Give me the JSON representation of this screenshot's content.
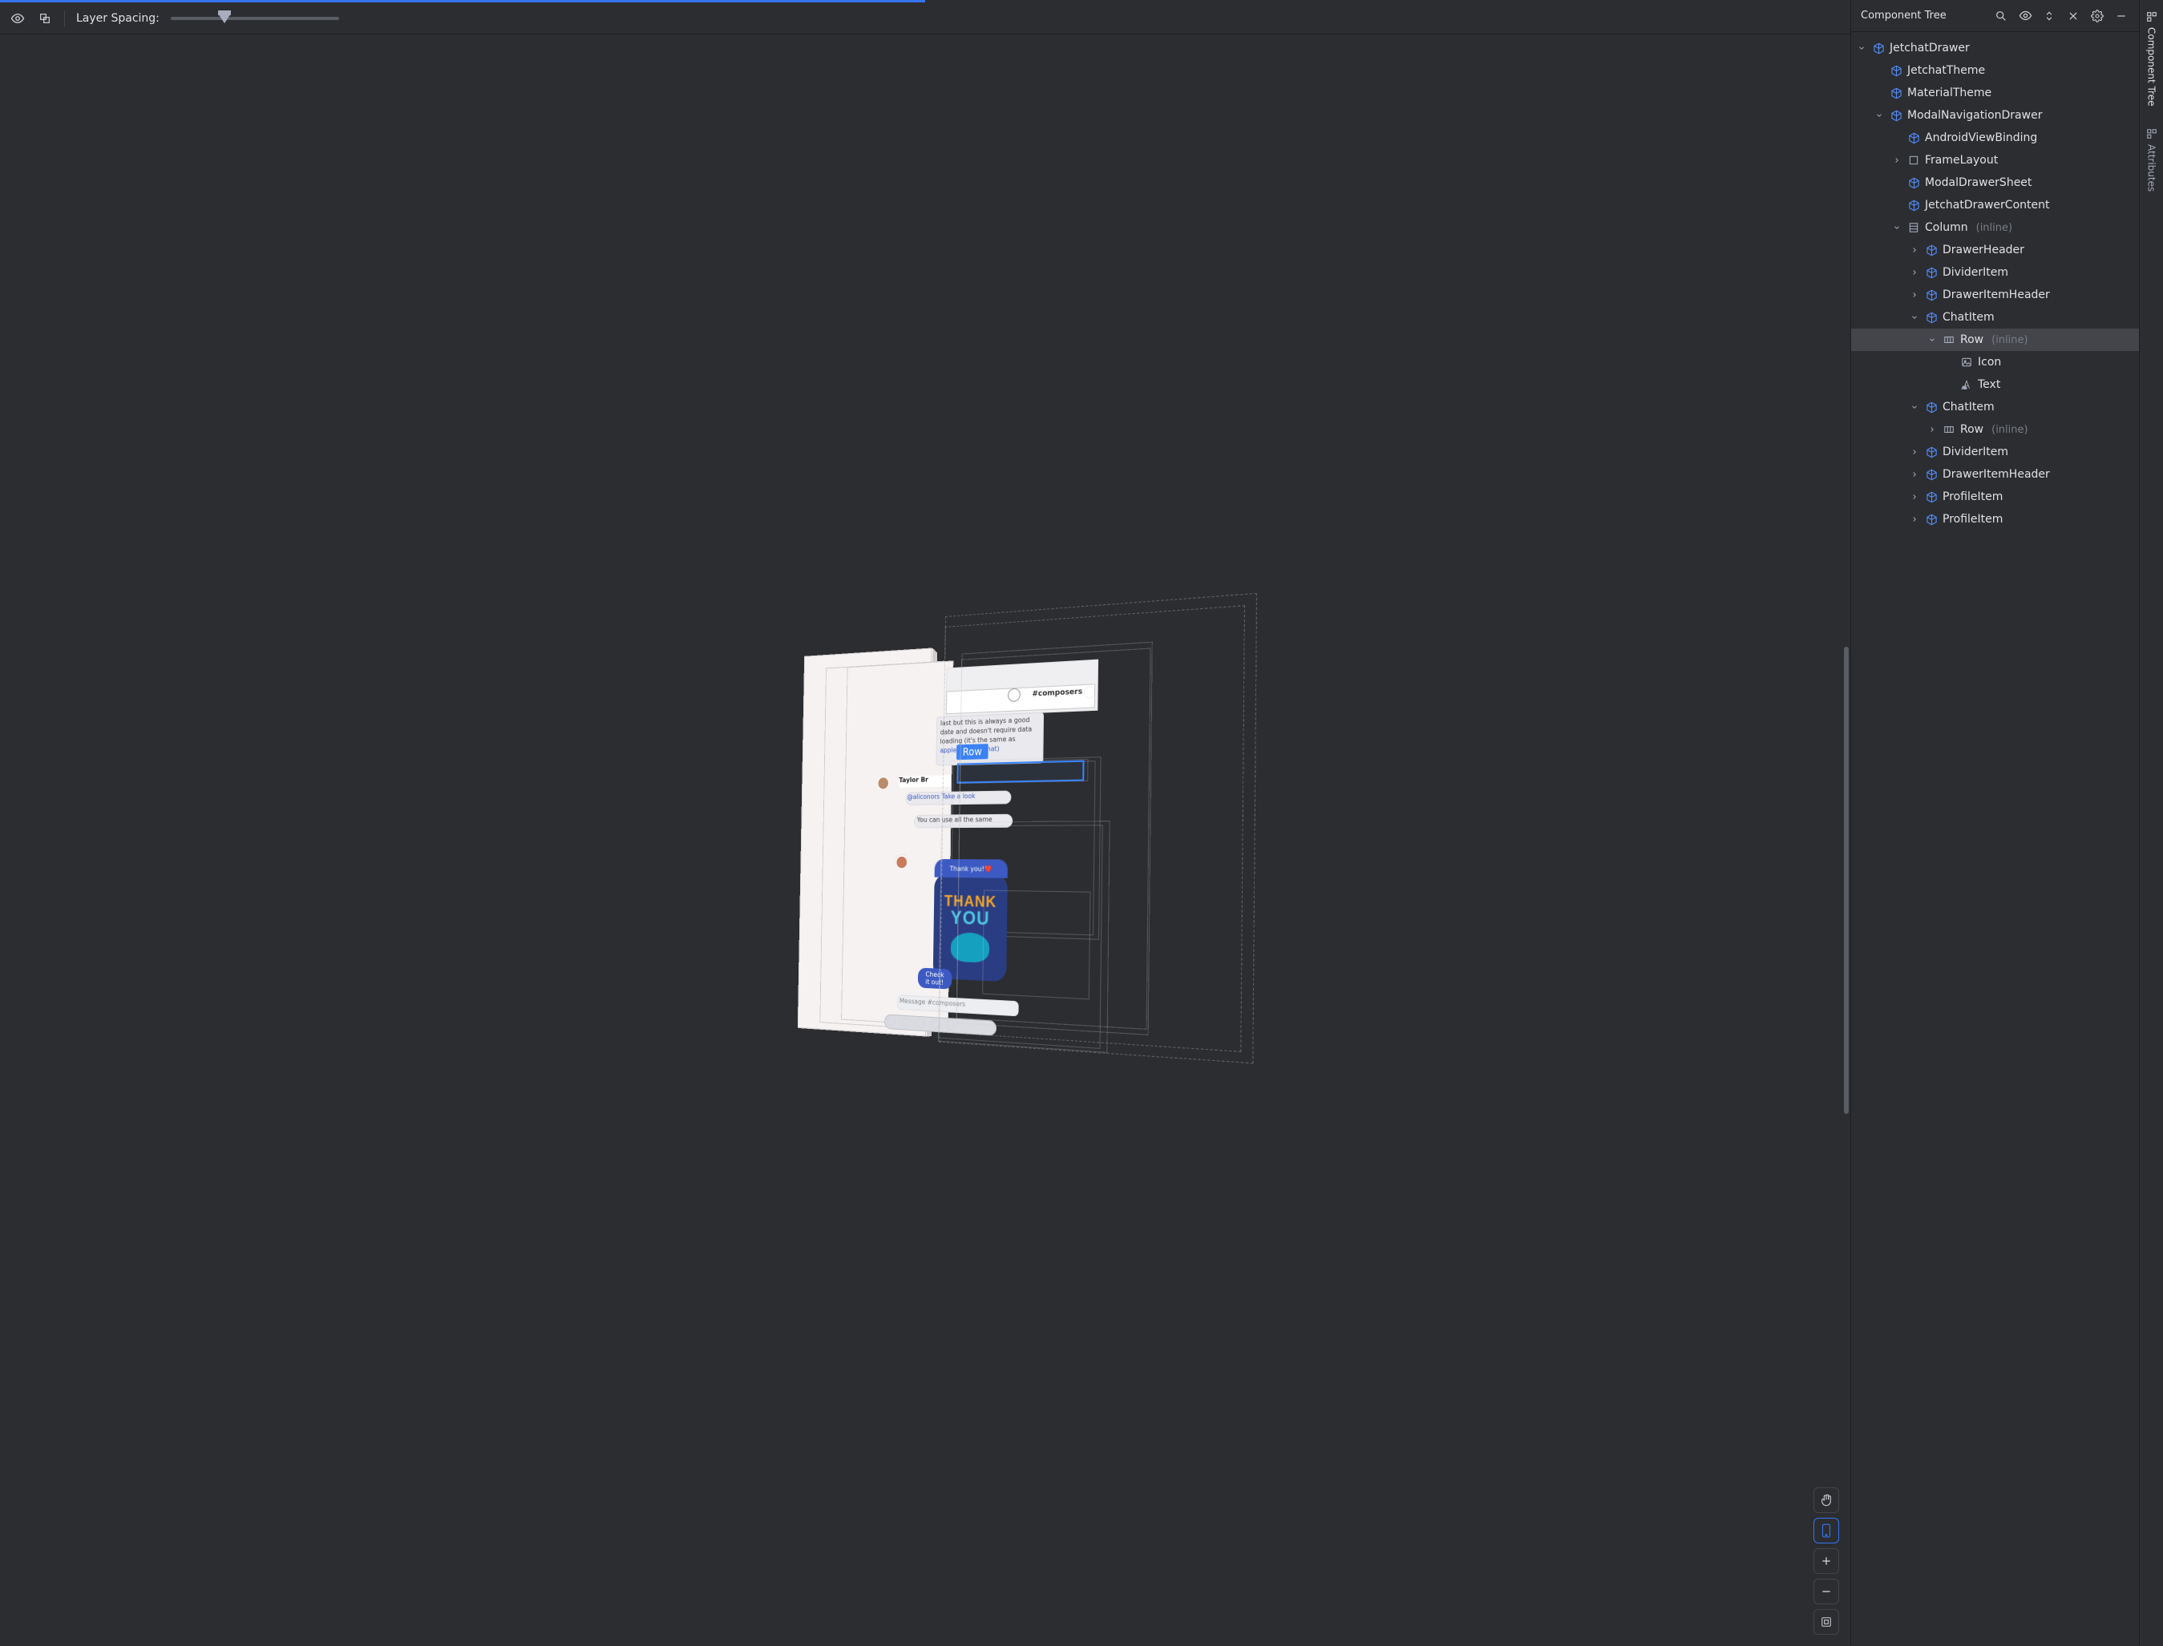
{
  "toolbar": {
    "layer_spacing_label": "Layer Spacing:"
  },
  "canvas": {
    "selection_label": "Row",
    "topbar_channel": "#composers",
    "message_name": "Taylor Br",
    "message_mention": "@aliconors Take a look",
    "thankyou_small": "Thank you!❤️",
    "thankyou_thank": "THANK",
    "thankyou_you": "YOU",
    "checkit": "Check it out!",
    "snippet_top1": "last but this is always a good",
    "snippet_top2": "date and doesn't require data",
    "snippet_top3": "loading (it's the same as",
    "snippet_top4": "apple.co/2nJetchat)",
    "snippet_mid1": "You can use all the same",
    "snippet_bottom": "Message #composers"
  },
  "right_panel": {
    "title": "Component Tree"
  },
  "tree": [
    {
      "depth": 0,
      "chev": "down",
      "icon": "cube",
      "label": "JetchatDrawer"
    },
    {
      "depth": 1,
      "chev": "none",
      "icon": "cube",
      "label": "JetchatTheme"
    },
    {
      "depth": 1,
      "chev": "none",
      "icon": "cube",
      "label": "MaterialTheme"
    },
    {
      "depth": 1,
      "chev": "down",
      "icon": "cube",
      "label": "ModalNavigationDrawer"
    },
    {
      "depth": 2,
      "chev": "none",
      "icon": "cube",
      "label": "AndroidViewBinding"
    },
    {
      "depth": 2,
      "chev": "right",
      "icon": "box",
      "label": "FrameLayout"
    },
    {
      "depth": 2,
      "chev": "none",
      "icon": "cube",
      "label": "ModalDrawerSheet"
    },
    {
      "depth": 2,
      "chev": "none",
      "icon": "cube",
      "label": "JetchatDrawerContent"
    },
    {
      "depth": 2,
      "chev": "down",
      "icon": "column",
      "label": "Column",
      "inline": "(inline)"
    },
    {
      "depth": 3,
      "chev": "right",
      "icon": "cube",
      "label": "DrawerHeader",
      "guide": true
    },
    {
      "depth": 3,
      "chev": "right",
      "icon": "cube",
      "label": "DividerItem",
      "guide": true
    },
    {
      "depth": 3,
      "chev": "right",
      "icon": "cube",
      "label": "DrawerItemHeader",
      "guide": true
    },
    {
      "depth": 3,
      "chev": "down",
      "icon": "cube",
      "label": "ChatItem",
      "guide": true
    },
    {
      "depth": 4,
      "chev": "down",
      "icon": "row",
      "label": "Row",
      "inline": "(inline)",
      "selected": true,
      "guide": true
    },
    {
      "depth": 5,
      "chev": "none",
      "icon": "image",
      "label": "Icon",
      "guide": true
    },
    {
      "depth": 5,
      "chev": "none",
      "icon": "text",
      "label": "Text",
      "guide": true,
      "last": true
    },
    {
      "depth": 3,
      "chev": "down",
      "icon": "cube",
      "label": "ChatItem",
      "guide": true
    },
    {
      "depth": 4,
      "chev": "right",
      "icon": "row",
      "label": "Row",
      "inline": "(inline)",
      "guide": true,
      "last": true
    },
    {
      "depth": 3,
      "chev": "right",
      "icon": "cube",
      "label": "DividerItem",
      "guide": true
    },
    {
      "depth": 3,
      "chev": "right",
      "icon": "cube",
      "label": "DrawerItemHeader",
      "guide": true
    },
    {
      "depth": 3,
      "chev": "right",
      "icon": "cube",
      "label": "ProfileItem",
      "guide": true
    },
    {
      "depth": 3,
      "chev": "right",
      "icon": "cube",
      "label": "ProfileItem",
      "guide": true,
      "last": true
    }
  ],
  "vtabs": {
    "component_tree": "Component Tree",
    "attributes": "Attributes"
  }
}
